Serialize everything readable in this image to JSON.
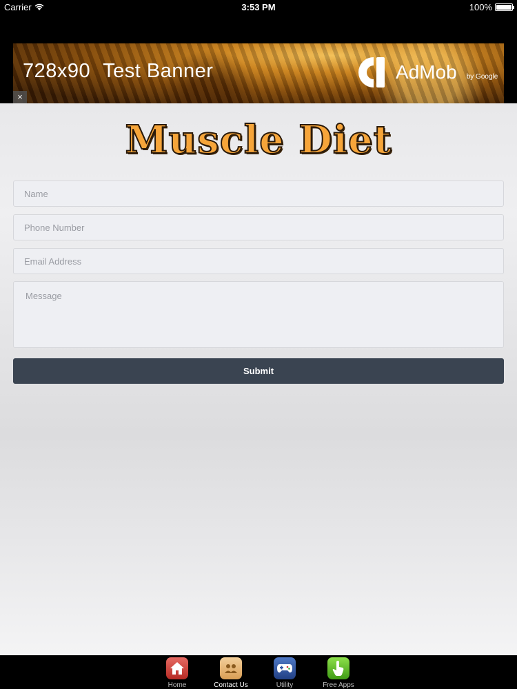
{
  "status_bar": {
    "carrier": "Carrier",
    "time": "3:53 PM",
    "battery": "100%"
  },
  "ad": {
    "text_size": "728x90",
    "text_label": "Test Banner",
    "brand": "AdMob",
    "brand_by": "by Google",
    "close": "×"
  },
  "app": {
    "logo": "Muscle Diet"
  },
  "form": {
    "name_placeholder": "Name",
    "phone_placeholder": "Phone Number",
    "email_placeholder": "Email Address",
    "message_placeholder": "Message",
    "submit_label": "Submit"
  },
  "tabs": [
    {
      "label": "Home",
      "icon": "home-icon",
      "color": "#d24a43"
    },
    {
      "label": "Contact Us",
      "icon": "contacts-icon",
      "color": "#e8b878",
      "active": true
    },
    {
      "label": "Utility",
      "icon": "gamepad-icon",
      "color": "#355ba6"
    },
    {
      "label": "Free Apps",
      "icon": "hand-pointer-icon",
      "color": "#62bd2d"
    }
  ]
}
